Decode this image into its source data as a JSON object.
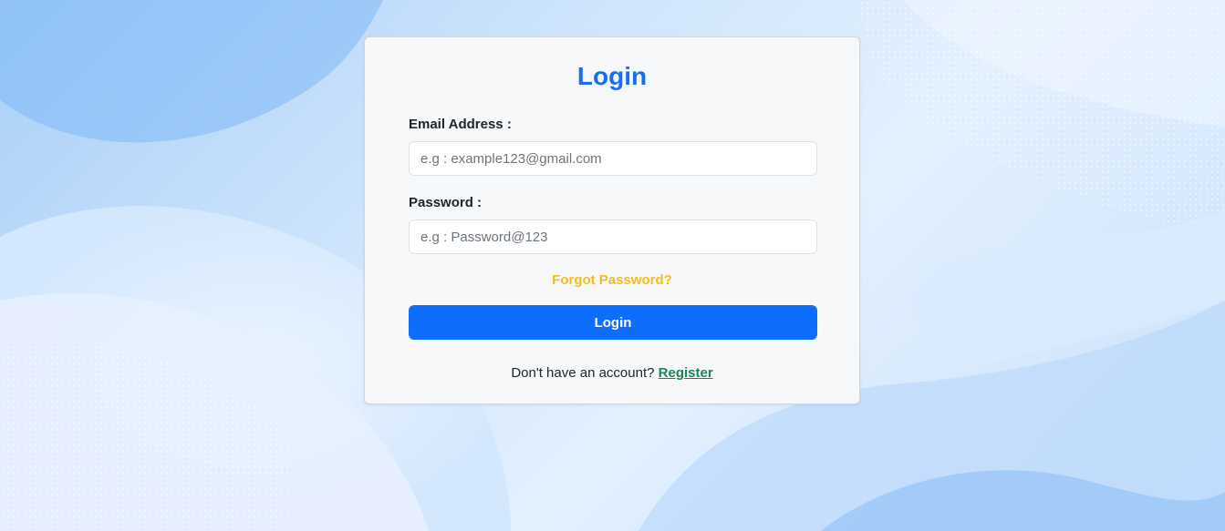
{
  "login_form": {
    "title": "Login",
    "email": {
      "label": "Email Address :",
      "placeholder": "e.g : example123@gmail.com",
      "value": ""
    },
    "password": {
      "label": "Password :",
      "placeholder": "e.g : Password@123",
      "value": ""
    },
    "forgot_password_label": "Forgot Password?",
    "submit_label": "Login",
    "register_prompt": "Don't have an account?",
    "register_label": "Register"
  },
  "colors": {
    "title": "#1a6ef0",
    "primary_button": "#0d6efd",
    "forgot_link": "#f5bd1f",
    "register_link": "#198754",
    "card_background": "#f7f8fa",
    "page_background": "#cfe5fc"
  }
}
